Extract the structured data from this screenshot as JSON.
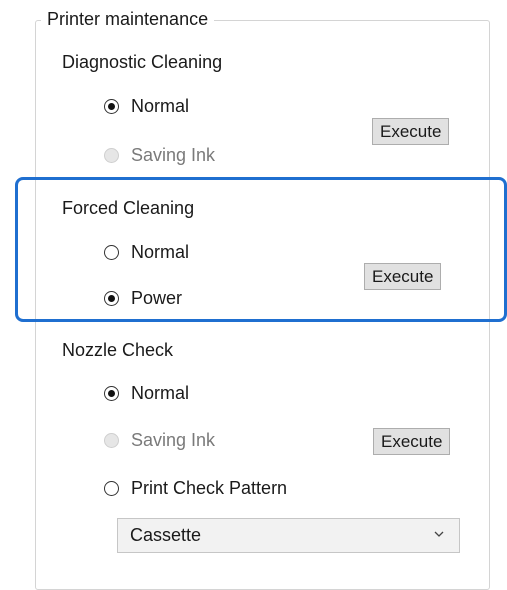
{
  "group": {
    "title": "Printer maintenance"
  },
  "diagnostic_cleaning": {
    "title": "Diagnostic Cleaning",
    "options": [
      "Normal",
      "Saving Ink"
    ],
    "execute_label": "Execute"
  },
  "forced_cleaning": {
    "title": "Forced Cleaning",
    "options": [
      "Normal",
      "Power"
    ],
    "execute_label": "Execute"
  },
  "nozzle_check": {
    "title": "Nozzle Check",
    "options": [
      "Normal",
      "Saving Ink",
      "Print Check Pattern"
    ],
    "execute_label": "Execute",
    "paper_source": "Cassette"
  },
  "colors": {
    "highlight": "#1f6fd0"
  }
}
